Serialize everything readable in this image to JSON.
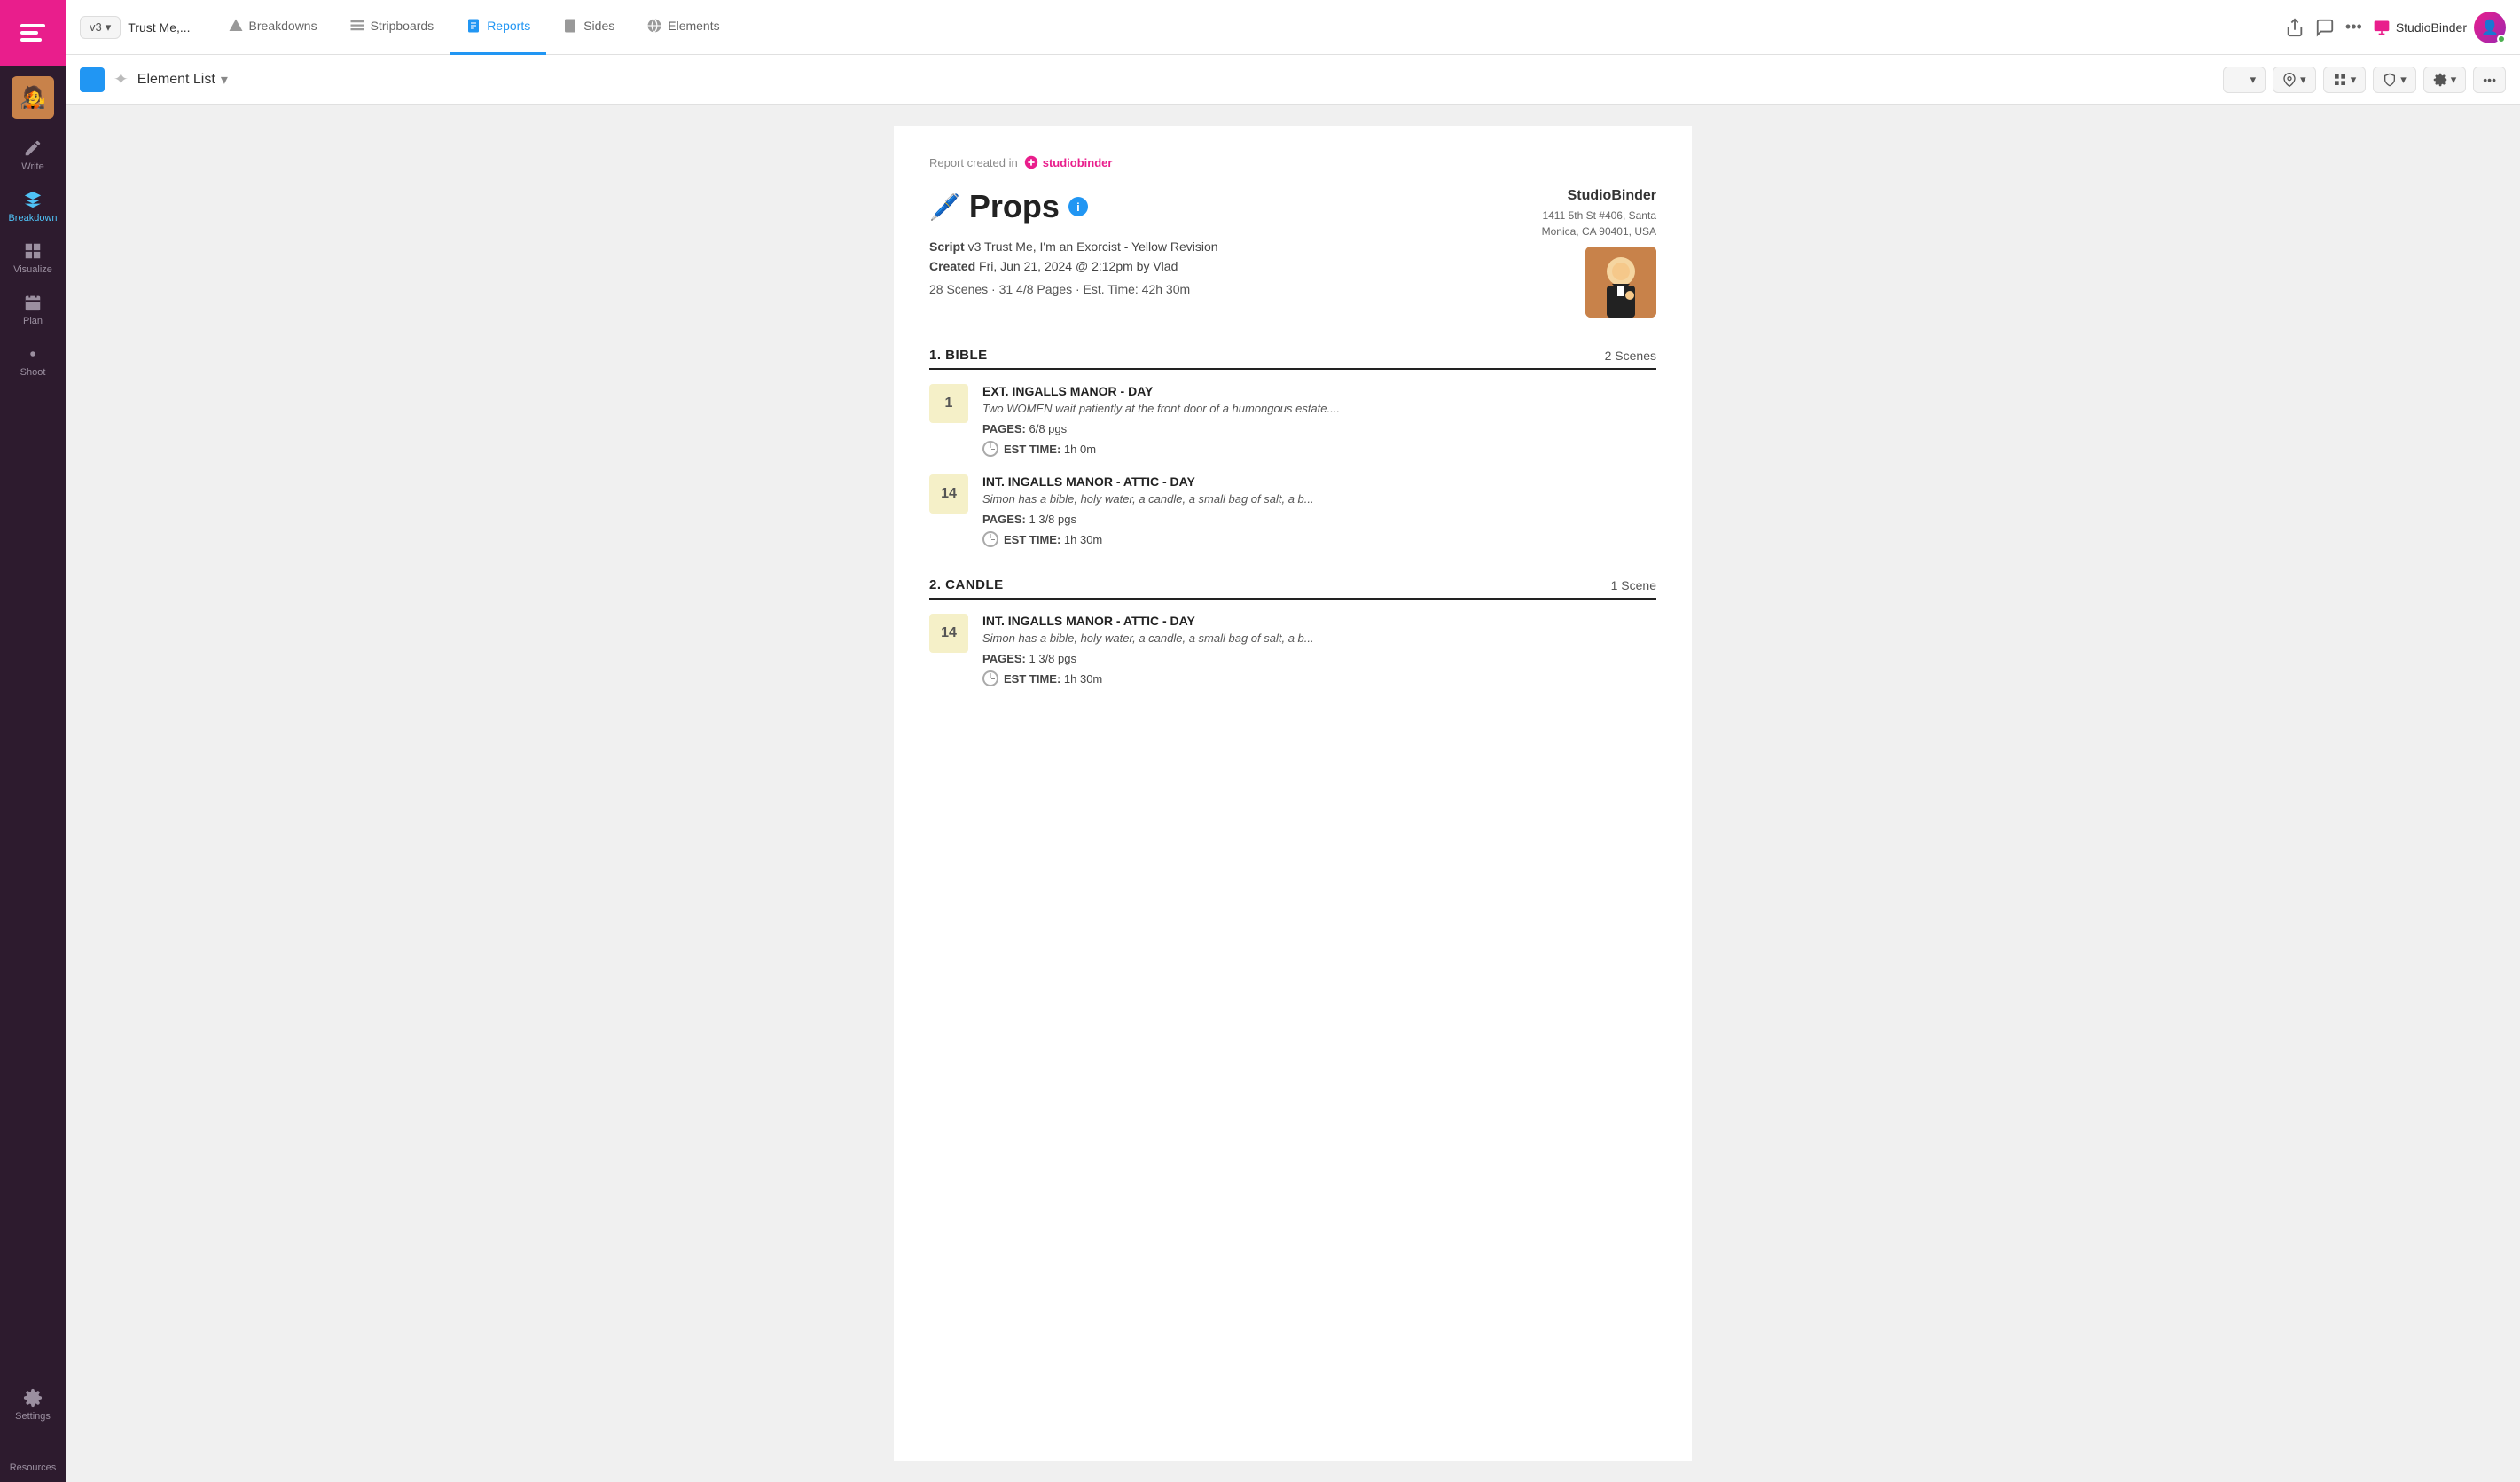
{
  "app": {
    "logo_label": "StudioBinder App"
  },
  "sidebar": {
    "items": [
      {
        "label": "Write",
        "icon": "write-icon",
        "active": false
      },
      {
        "label": "Breakdown",
        "icon": "breakdown-icon",
        "active": false
      },
      {
        "label": "Visualize",
        "icon": "visualize-icon",
        "active": false
      },
      {
        "label": "Plan",
        "icon": "plan-icon",
        "active": false
      },
      {
        "label": "Shoot",
        "icon": "shoot-icon",
        "active": false
      },
      {
        "label": "Settings",
        "icon": "settings-icon",
        "active": false
      },
      {
        "label": "Resources",
        "icon": "resources-icon",
        "active": false
      }
    ]
  },
  "topnav": {
    "version": "v3",
    "project_name": "Trust Me,...",
    "tabs": [
      {
        "label": "Breakdowns",
        "icon": "breakdowns-icon",
        "active": false
      },
      {
        "label": "Stripboards",
        "icon": "stripboards-icon",
        "active": false
      },
      {
        "label": "Reports",
        "icon": "reports-icon",
        "active": true
      },
      {
        "label": "Sides",
        "icon": "sides-icon",
        "active": false
      },
      {
        "label": "Elements",
        "icon": "elements-icon",
        "active": false
      }
    ],
    "user_name": "StudioBinder",
    "more_label": "•••"
  },
  "toolbar": {
    "title": "Element List",
    "chevron_label": "▾"
  },
  "report": {
    "created_label": "Report created in",
    "brand": "studiobinder",
    "title": "Props",
    "info_icon_label": "i",
    "pencil_emoji": "🖊️",
    "script_label": "Script",
    "script_version": "v3",
    "script_name": "Trust Me, I'm an Exorcist - Yellow Revision",
    "created_label2": "Created",
    "created_date": "Fri, Jun 21, 2024 @ 2:12pm",
    "created_by": "by Vlad",
    "stats": "28 Scenes  ·  31 4/8 Pages  ·  Est. Time: 42h 30m",
    "company": {
      "name": "StudioBinder",
      "address_line1": "1411 5th St #406, Santa",
      "address_line2": "Monica, CA 90401, USA"
    },
    "sections": [
      {
        "number": "1",
        "title": "BIBLE",
        "scene_count": "2 Scenes",
        "scenes": [
          {
            "number": "1",
            "name": "EXT. INGALLS MANOR - DAY",
            "description": "Two WOMEN wait patiently at the front door of a humongous estate....",
            "pages_label": "PAGES:",
            "pages": "6/8 pgs",
            "est_time_label": "EST TIME:",
            "est_time": "1h 0m"
          },
          {
            "number": "14",
            "name": "INT. INGALLS MANOR - ATTIC - DAY",
            "description": "Simon has a bible, holy water, a candle, a small bag of salt, a b...",
            "pages_label": "PAGES:",
            "pages": "1 3/8 pgs",
            "est_time_label": "EST TIME:",
            "est_time": "1h 30m"
          }
        ]
      },
      {
        "number": "2",
        "title": "CANDLE",
        "scene_count": "1 Scene",
        "scenes": [
          {
            "number": "14",
            "name": "INT. INGALLS MANOR - ATTIC - DAY",
            "description": "Simon has a bible, holy water, a candle, a small bag of salt, a b...",
            "pages_label": "PAGES:",
            "pages": "1 3/8 pgs",
            "est_time_label": "EST TIME:",
            "est_time": "1h 30m"
          }
        ]
      }
    ]
  }
}
